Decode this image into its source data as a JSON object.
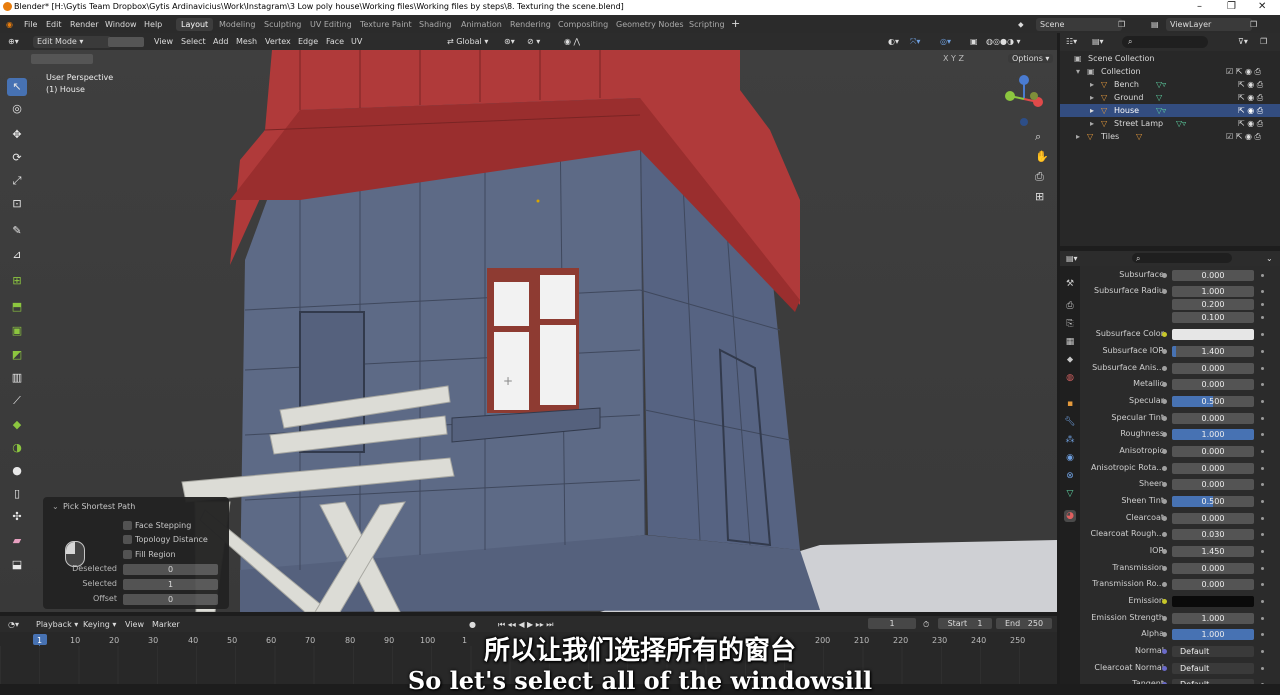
{
  "window": {
    "title": "Blender* [H:\\Gytis Team Dropbox\\Gytis Ardinavicius\\Work\\Instagram\\3 Low poly house\\Working files\\Working files by steps\\8. Texturing the scene.blend]"
  },
  "menu": [
    "File",
    "Edit",
    "Render",
    "Window",
    "Help"
  ],
  "workspaces": [
    "Layout",
    "Modeling",
    "Sculpting",
    "UV Editing",
    "Texture Paint",
    "Shading",
    "Animation",
    "Rendering",
    "Compositing",
    "Geometry Nodes",
    "Scripting"
  ],
  "active_workspace": "Layout",
  "scene": {
    "name": "Scene",
    "view_layer": "ViewLayer"
  },
  "viewport_header": {
    "mode": "Edit Mode",
    "menus": [
      "View",
      "Select",
      "Add",
      "Mesh",
      "Vertex",
      "Edge",
      "Face",
      "UV"
    ],
    "orientation": "Global",
    "axes": [
      "X",
      "Y",
      "Z"
    ],
    "options": "Options"
  },
  "viewport": {
    "perspective": "User Perspective",
    "object": "(1) House"
  },
  "operator_panel": {
    "title": "Pick Shortest Path",
    "checkboxes": [
      "Face Stepping",
      "Topology Distance",
      "Fill Region"
    ],
    "fields": [
      {
        "label": "Deselected",
        "value": "0"
      },
      {
        "label": "Selected",
        "value": "1"
      },
      {
        "label": "Offset",
        "value": "0"
      }
    ]
  },
  "timeline": {
    "menus": [
      "Playback",
      "Keying",
      "View",
      "Marker"
    ],
    "current_frame": "1",
    "start_label": "Start",
    "start": "1",
    "end_label": "End",
    "end": "250",
    "ticks": [
      "1",
      "10",
      "20",
      "30",
      "40",
      "50",
      "60",
      "70",
      "80",
      "90",
      "100",
      "1",
      "200",
      "210",
      "220",
      "230",
      "240",
      "250"
    ]
  },
  "outliner": {
    "root": "Scene Collection",
    "collection": "Collection",
    "items": [
      {
        "name": "Bench",
        "selected": false
      },
      {
        "name": "Ground",
        "selected": false
      },
      {
        "name": "House",
        "selected": true
      },
      {
        "name": "Street Lamp",
        "selected": false
      },
      {
        "name": "Tiles",
        "selected": false
      }
    ]
  },
  "properties": [
    {
      "label": "Subsurface",
      "value": "0.000"
    },
    {
      "label": "Subsurface Radiu",
      "value": "1.000"
    },
    {
      "label": "",
      "value": "0.200"
    },
    {
      "label": "",
      "value": "0.100"
    },
    {
      "label": "Subsurface Color",
      "value": "",
      "color": "#e6e6e6"
    },
    {
      "label": "Subsurface IOR",
      "value": "1.400",
      "fill": 0.05
    },
    {
      "label": "Subsurface Anis...",
      "value": "0.000"
    },
    {
      "label": "Metallic",
      "value": "0.000"
    },
    {
      "label": "Specular",
      "value": "0.500",
      "fill": 0.5
    },
    {
      "label": "Specular Tint",
      "value": "0.000"
    },
    {
      "label": "Roughness",
      "value": "1.000",
      "fill": 1.0
    },
    {
      "label": "Anisotropic",
      "value": "0.000"
    },
    {
      "label": "Anisotropic Rota...",
      "value": "0.000"
    },
    {
      "label": "Sheen",
      "value": "0.000"
    },
    {
      "label": "Sheen Tint",
      "value": "0.500",
      "fill": 0.5
    },
    {
      "label": "Clearcoat",
      "value": "0.000"
    },
    {
      "label": "Clearcoat Rough...",
      "value": "0.030"
    },
    {
      "label": "IOR",
      "value": "1.450"
    },
    {
      "label": "Transmission",
      "value": "0.000"
    },
    {
      "label": "Transmission Ro...",
      "value": "0.000"
    },
    {
      "label": "Emission",
      "value": "",
      "color": "#0a0a0a"
    },
    {
      "label": "Emission Strength",
      "value": "1.000"
    },
    {
      "label": "Alpha",
      "value": "1.000",
      "fill": 1.0
    },
    {
      "label": "Normal",
      "value": "Default"
    },
    {
      "label": "Clearcoat Normal",
      "value": "Default"
    },
    {
      "label": "Tangent",
      "value": "Default"
    }
  ],
  "subtitles": {
    "chinese": "所以让我们选择所有的窗台",
    "english": "So let's select all of the windowsill"
  }
}
